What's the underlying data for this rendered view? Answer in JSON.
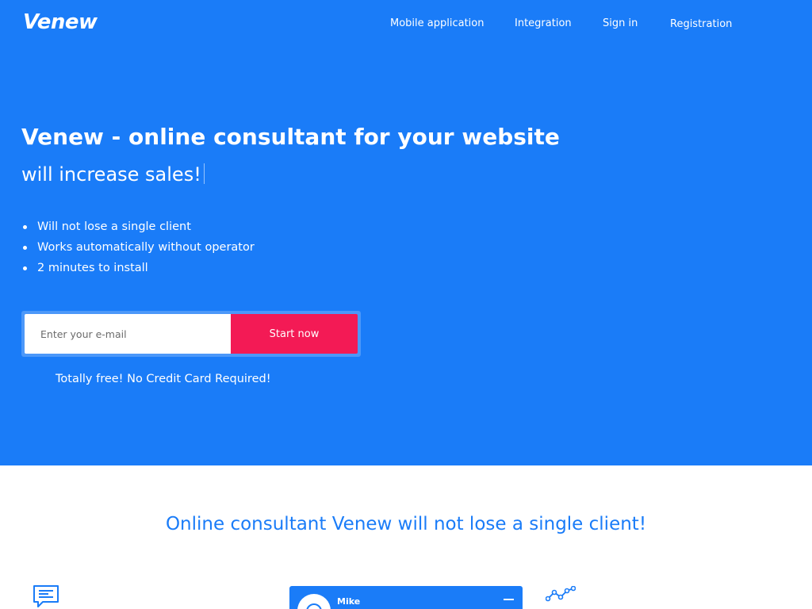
{
  "header": {
    "logo": "Venew",
    "nav": [
      {
        "label": "Mobile application"
      },
      {
        "label": "Integration"
      },
      {
        "label": "Sign in"
      },
      {
        "label": "Registration"
      }
    ]
  },
  "hero": {
    "title": "Venew - online consultant for your website",
    "subtitle": "will increase sales!",
    "features": [
      "Will not lose a single client",
      "Works automatically without operator",
      "2 minutes to install"
    ],
    "email_placeholder": "Enter your e-mail",
    "start_label": "Start now",
    "free_note": "Totally free! No Credit Card Required!"
  },
  "section": {
    "title": "Online consultant Venew will not lose a single client!",
    "chat_widget": {
      "agent_name": "Mike"
    }
  },
  "colors": {
    "brand_blue": "#1a7cf8",
    "cta_red": "#f31a55"
  },
  "icons": [
    "chat-lines-icon",
    "line-graph-icon",
    "avatar-icon",
    "minimize-icon"
  ]
}
